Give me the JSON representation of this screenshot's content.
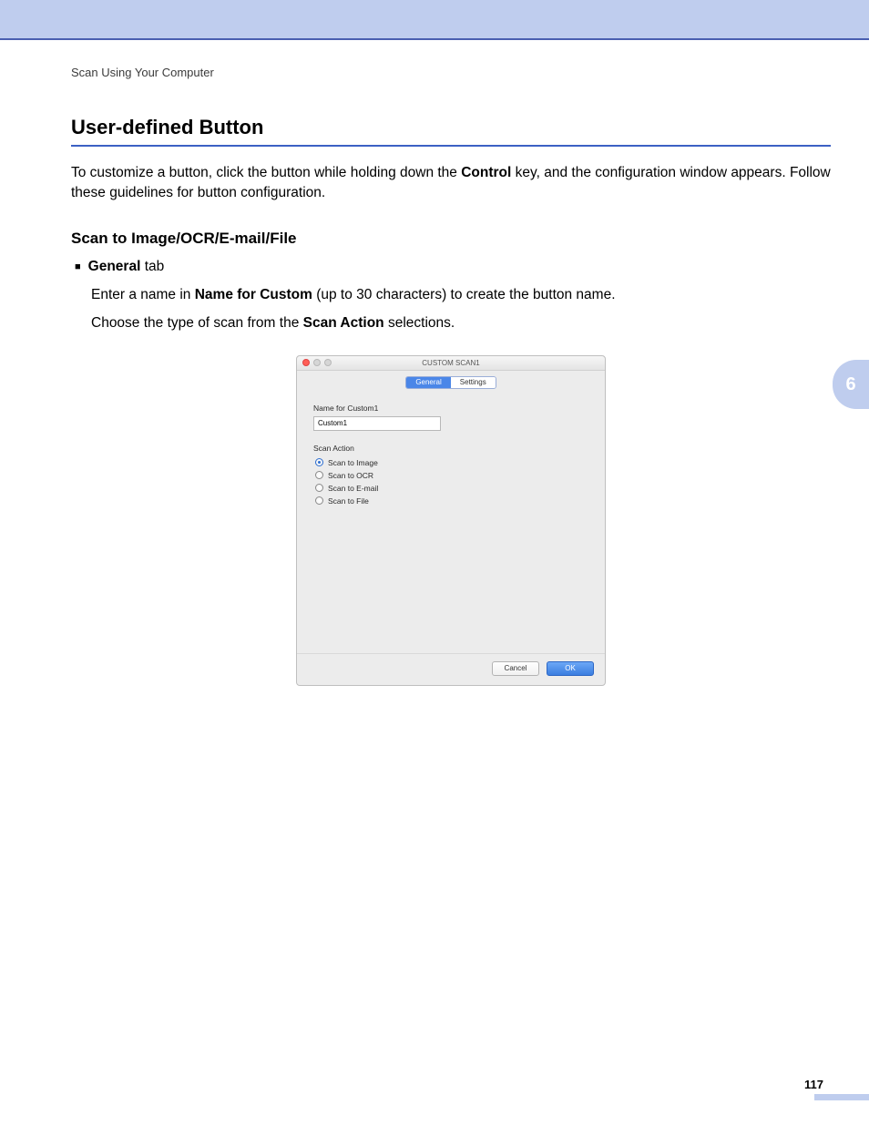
{
  "breadcrumb": "Scan Using Your Computer",
  "heading": "User-defined Button",
  "intro": {
    "prefix": "To customize a button, click the button while holding down the ",
    "bold": "Control",
    "suffix": " key, and the configuration window appears. Follow these guidelines for button configuration."
  },
  "subheading": "Scan to Image/OCR/E-mail/File",
  "bullet": {
    "bold": "General",
    "rest": " tab"
  },
  "line1": {
    "prefix": "Enter a name in ",
    "bold": "Name for Custom",
    "suffix": " (up to 30 characters) to create the button name."
  },
  "line2": {
    "prefix": "Choose the type of scan from the ",
    "bold": "Scan Action",
    "suffix": " selections."
  },
  "dialog": {
    "title": "CUSTOM SCAN1",
    "tabs": {
      "general": "General",
      "settings": "Settings"
    },
    "name_label": "Name for Custom1",
    "name_value": "Custom1",
    "action_label": "Scan Action",
    "options": {
      "image": "Scan to Image",
      "ocr": "Scan to OCR",
      "email": "Scan to E-mail",
      "file": "Scan to File"
    },
    "cancel": "Cancel",
    "ok": "OK"
  },
  "chapter": "6",
  "page_number": "117"
}
